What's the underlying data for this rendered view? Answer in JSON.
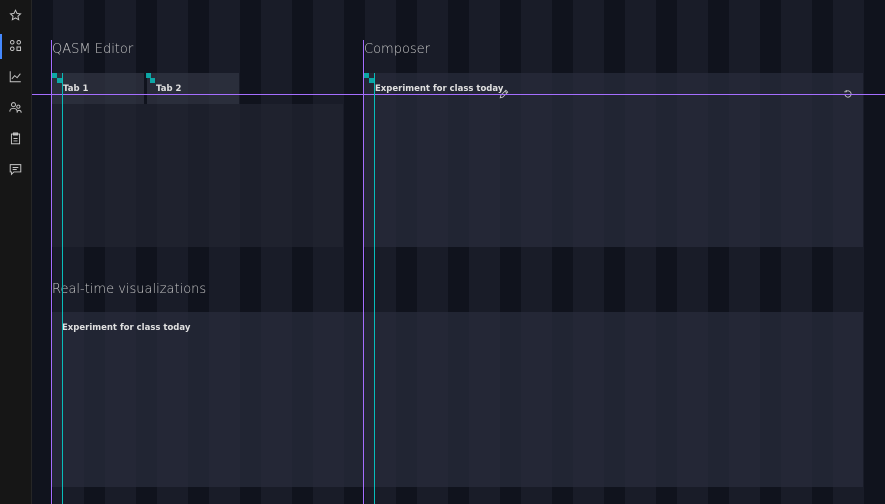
{
  "sidebar": {
    "items": [
      {
        "name": "star",
        "active": false
      },
      {
        "name": "composer",
        "active": true
      },
      {
        "name": "chart",
        "active": false
      },
      {
        "name": "users",
        "active": false
      },
      {
        "name": "clipboard",
        "active": false
      },
      {
        "name": "chat",
        "active": false
      }
    ]
  },
  "qasm_editor": {
    "title": "QASM Editor",
    "tabs": [
      {
        "label": "Tab 1"
      },
      {
        "label": "Tab 2"
      }
    ]
  },
  "composer": {
    "title": "Composer",
    "experiment_name": "Experiment for class today"
  },
  "visualizations": {
    "title": "Real-time visualizations",
    "experiment_name": "Experiment for class today"
  },
  "colors": {
    "accent": "#4589ff",
    "guide_purple": "#a56eff",
    "guide_teal": "#08bdba"
  }
}
